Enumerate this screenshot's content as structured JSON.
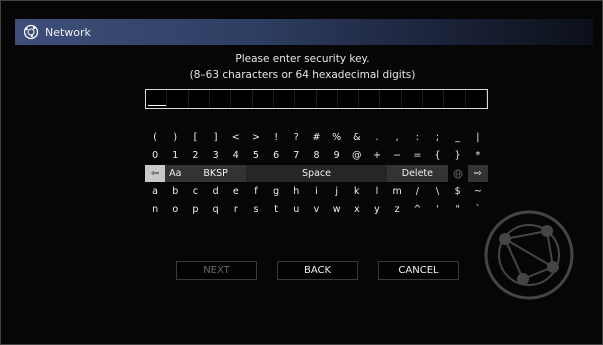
{
  "header": {
    "title": "Network",
    "icon": "globe-network-icon"
  },
  "prompt": {
    "line1": "Please enter security key.",
    "line2": "(8–63 characters or 64 hexadecimal digits)"
  },
  "key_field": {
    "value": "",
    "max_length": 64
  },
  "keyboard": {
    "row1": [
      "(",
      ")",
      "[",
      "]",
      "<",
      ">",
      "!",
      "?",
      "#",
      "%",
      "&",
      ".",
      ",",
      ":",
      ";",
      "_",
      "|"
    ],
    "row2": [
      "0",
      "1",
      "2",
      "3",
      "4",
      "5",
      "6",
      "7",
      "8",
      "9",
      "@",
      "+",
      "−",
      "=",
      "{",
      "}",
      "*"
    ],
    "row3": {
      "left_arrow": "⇦",
      "case_toggle": "Aa",
      "backspace": "BKSP",
      "space": "Space",
      "delete": "Delete",
      "globe_key_icon": "globe-icon",
      "right_arrow": "⇨"
    },
    "row4": [
      "a",
      "b",
      "c",
      "d",
      "e",
      "f",
      "g",
      "h",
      "i",
      "j",
      "k",
      "l",
      "m",
      "/",
      "\\",
      "$",
      "~"
    ],
    "row5": [
      "n",
      "o",
      "p",
      "q",
      "r",
      "s",
      "t",
      "u",
      "v",
      "w",
      "x",
      "y",
      "z",
      "^",
      "'",
      "\"",
      "`"
    ]
  },
  "buttons": {
    "next": "NEXT",
    "back": "BACK",
    "cancel": "CANCEL"
  },
  "colors": {
    "title_bar": "#3d4f7a",
    "background": "#060606",
    "key_dark": "#262626",
    "key_selected": "#c9c9c9"
  }
}
